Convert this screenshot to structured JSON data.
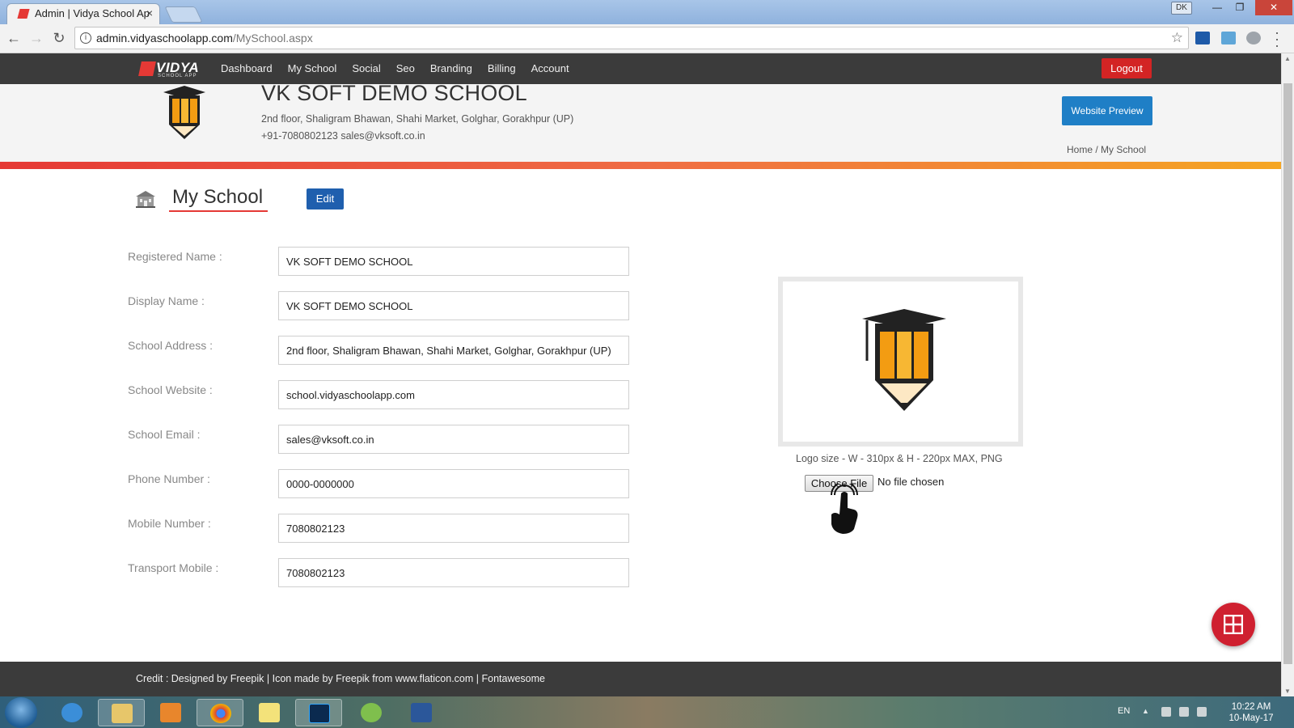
{
  "browser": {
    "tab_title": "Admin | Vidya School Ap",
    "tab_close": "×",
    "profile": "DK",
    "url_domain": "admin.vidyaschoolapp.com",
    "url_path": "/MySchool.aspx",
    "window_min": "—",
    "window_max": "❐",
    "window_close": "✕"
  },
  "nav": {
    "logo_word": "VIDYA",
    "logo_sub": "SCHOOL APP",
    "items": [
      "Dashboard",
      "My School",
      "Social",
      "Seo",
      "Branding",
      "Billing",
      "Account"
    ],
    "logout": "Logout"
  },
  "school": {
    "name": "VK SOFT DEMO SCHOOL",
    "address": "2nd floor, Shaligram Bhawan, Shahi Market, Golghar, Gorakhpur (UP)",
    "contact": "+91-7080802123  sales@vksoft.co.in",
    "preview_button": "Website Preview",
    "breadcrumb": "Home / My School"
  },
  "page": {
    "title": "My School",
    "edit_button": "Edit"
  },
  "form": {
    "fields": [
      {
        "label": "Registered Name :",
        "value": "VK SOFT DEMO SCHOOL"
      },
      {
        "label": "Display Name :",
        "value": "VK SOFT DEMO SCHOOL"
      },
      {
        "label": "School Address :",
        "value": "2nd floor, Shaligram Bhawan, Shahi Market, Golghar, Gorakhpur (UP)"
      },
      {
        "label": "School Website :",
        "value": "school.vidyaschoolapp.com"
      },
      {
        "label": "School Email :",
        "value": "sales@vksoft.co.in"
      },
      {
        "label": "Phone Number :",
        "value": "0000-0000000"
      },
      {
        "label": "Mobile Number :",
        "value": "7080802123"
      },
      {
        "label": "Transport Mobile :",
        "value": "7080802123"
      }
    ]
  },
  "logo_upload": {
    "note": "Logo size - W - 310px & H - 220px MAX, PNG",
    "choose_button": "Choose File",
    "status": "No file chosen"
  },
  "footer": {
    "credit": "Credit : Designed by Freepik | Icon made by Freepik from www.flaticon.com | Fontawesome"
  },
  "taskbar": {
    "lang": "EN",
    "time": "10:22 AM",
    "date": "10-May-17"
  },
  "colors": {
    "accent_red": "#e53935",
    "primary_blue": "#1f7fc6",
    "nav_dark": "#3b3b3b"
  }
}
